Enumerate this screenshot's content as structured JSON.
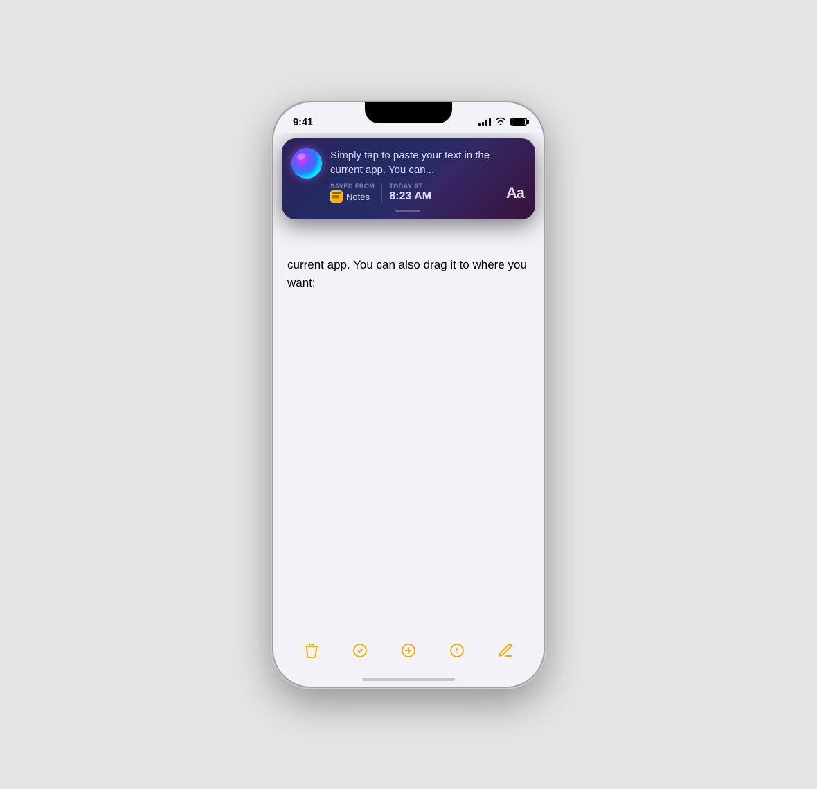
{
  "phone": {
    "status_bar": {
      "time": "9:41"
    },
    "siri_popup": {
      "main_text": "Simply tap to paste your text in the current app. You can...",
      "saved_from_label": "SAVED FROM",
      "today_at_label": "TODAY AT",
      "app_name": "Notes",
      "time_value": "8:23 AM",
      "aa_label": "Aa"
    },
    "notes_content": {
      "body_text": "current app. You can also drag it to where you want:"
    },
    "toolbar": {
      "delete_label": "delete",
      "checkmark_label": "checkmark",
      "add_label": "add",
      "location_label": "location",
      "compose_label": "compose"
    }
  }
}
